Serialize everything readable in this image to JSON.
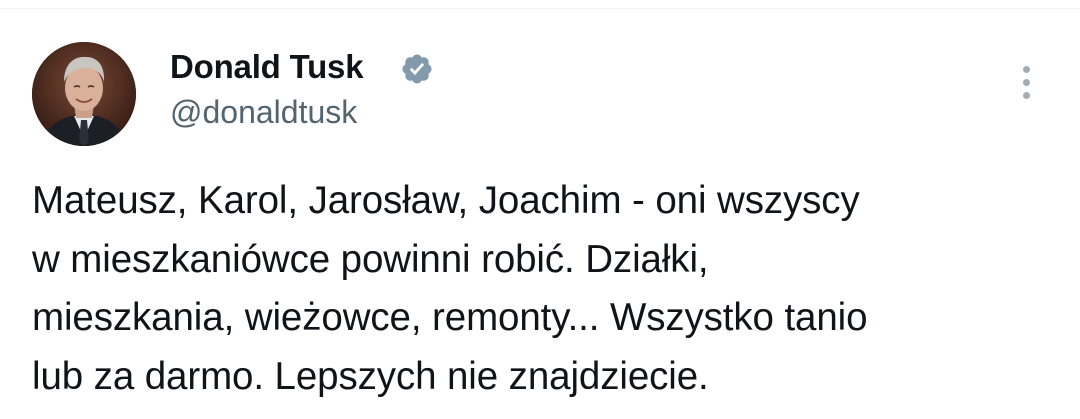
{
  "tweet": {
    "author": {
      "name": "Donald Tusk",
      "handle": "@donaldtusk",
      "verified": true
    },
    "text_lines": [
      "Mateusz, Karol, Jarosław, Joachim - oni wszyscy",
      "w mieszkaniówce powinni robić. Działki,",
      "mieszkania, wieżowce, remonty... Wszystko tanio",
      "lub za darmo. Lepszych nie znajdziecie."
    ]
  },
  "icons": {
    "verified": "verified-badge-icon",
    "more": "more-options-icon"
  },
  "colors": {
    "text": "#0f1419",
    "secondary_text": "#536471",
    "verified_badge": "#829aab",
    "divider": "#eff3f4"
  }
}
